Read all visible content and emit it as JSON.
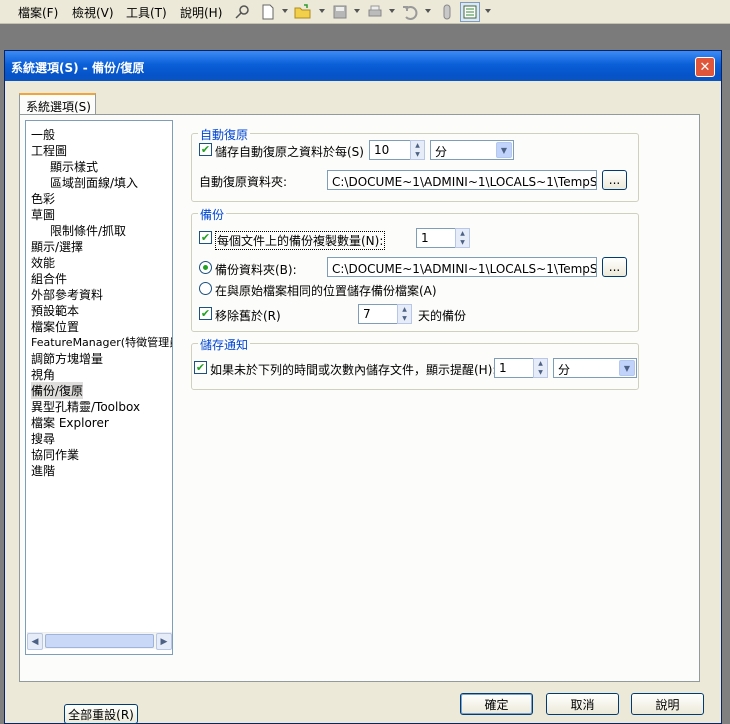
{
  "menubar": {
    "menus": [
      "檔案(F)",
      "檢視(V)",
      "工具(T)",
      "說明(H)"
    ],
    "toolbar_icons": [
      "pin-icon",
      "new-document-icon",
      "open-folder-icon",
      "save-icon",
      "print-icon",
      "undo-icon",
      "traffic-light-icon",
      "options-icon"
    ]
  },
  "dialog": {
    "title": "系統選項(S) - 備份/復原",
    "close_glyph": "✕",
    "tab_label": "系統選項(S)",
    "tree": {
      "items": [
        "一般",
        "工程圖",
        "顯示樣式",
        "區域剖面線/填入",
        "色彩",
        "草圖",
        "限制條件/抓取",
        "顯示/選擇",
        "效能",
        "組合件",
        "外部參考資料",
        "預設範本",
        "檔案位置",
        "FeatureManager(特徵管理員",
        "調節方塊增量",
        "視角",
        "備份/復原",
        "異型孔精靈/Toolbox",
        "檔案 Explorer",
        "搜尋",
        "協同作業",
        "進階"
      ],
      "selected": "備份/復原"
    },
    "reset_label": "全部重設(R)",
    "autorecover": {
      "legend": "自動復原",
      "save_label": "儲存自動復原之資料於每(S)",
      "save_checked": true,
      "interval": "10",
      "unit": "分",
      "folder_label": "自動復原資料夾:",
      "folder_path": "C:\\DOCUME~1\\ADMINI~1\\LOCALS~1\\TempSW備份目",
      "browse": "..."
    },
    "backup": {
      "legend": "備份",
      "copies_label": "每個文件上的備份複製數量(N):",
      "copies_checked": true,
      "copies": "1",
      "folder_radio_label": "備份資料夾(B):",
      "folder_radio_selected": true,
      "folder_path": "C:\\DOCUME~1\\ADMINI~1\\LOCALS~1\\TempSW備份目",
      "browse": "...",
      "same_location_label": "在與原始檔案相同的位置儲存備份檔案(A)",
      "remove_label": "移除舊於(R)",
      "remove_checked": true,
      "days": "7",
      "days_suffix": "天的備份"
    },
    "save_notify": {
      "legend": "儲存通知",
      "label": "如果未於下列的時間或次數內儲存文件，顯示提醒(H):",
      "checked": true,
      "value": "1",
      "unit": "分"
    },
    "buttons": {
      "ok": "確定",
      "cancel": "取消",
      "help": "說明"
    }
  }
}
